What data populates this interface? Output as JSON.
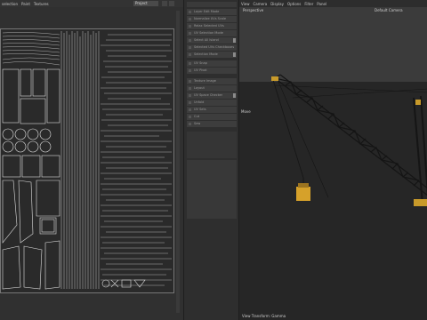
{
  "uv_editor": {
    "menu": [
      "selection",
      "Paint",
      "Textures"
    ],
    "dropdown_value": "Project"
  },
  "side_panel": {
    "rows": [
      {
        "label": "Layer Edit Mode",
        "toggle": false
      },
      {
        "label": "Normalize UVs Scale",
        "toggle": false
      },
      {
        "label": "Relax Selected UVs",
        "toggle": false
      },
      {
        "label": "UV Selection Mode",
        "toggle": false
      },
      {
        "label": "Select All Island",
        "toggle": true
      },
      {
        "label": "Selected UVs Checkboxes",
        "toggle": false
      },
      {
        "label": "Selection Mode",
        "toggle": true
      },
      {
        "label": "UV Snap",
        "toggle": false
      },
      {
        "label": "UV Pivot",
        "toggle": false
      },
      {
        "label": "Texture Image",
        "toggle": false
      },
      {
        "label": "Layout",
        "toggle": false
      },
      {
        "label": "UV Space Checker",
        "toggle": true
      },
      {
        "label": "Unfold",
        "toggle": false
      },
      {
        "label": "UV Sets",
        "toggle": false
      },
      {
        "label": "Cut",
        "toggle": false
      },
      {
        "label": "Sew",
        "toggle": false
      }
    ]
  },
  "viewport": {
    "menu": [
      "View",
      "Camera",
      "Display",
      "Options",
      "Filter",
      "Panel"
    ],
    "hud_left": "Perspective",
    "hud_center": "Default Camera",
    "left_marker": "Move",
    "footer": "View Transform: Gamma"
  },
  "colors": {
    "crane_steel": "#1c1c1c",
    "crane_highlight": "#c89a2a",
    "uv_lines": "#d8d8d8"
  }
}
